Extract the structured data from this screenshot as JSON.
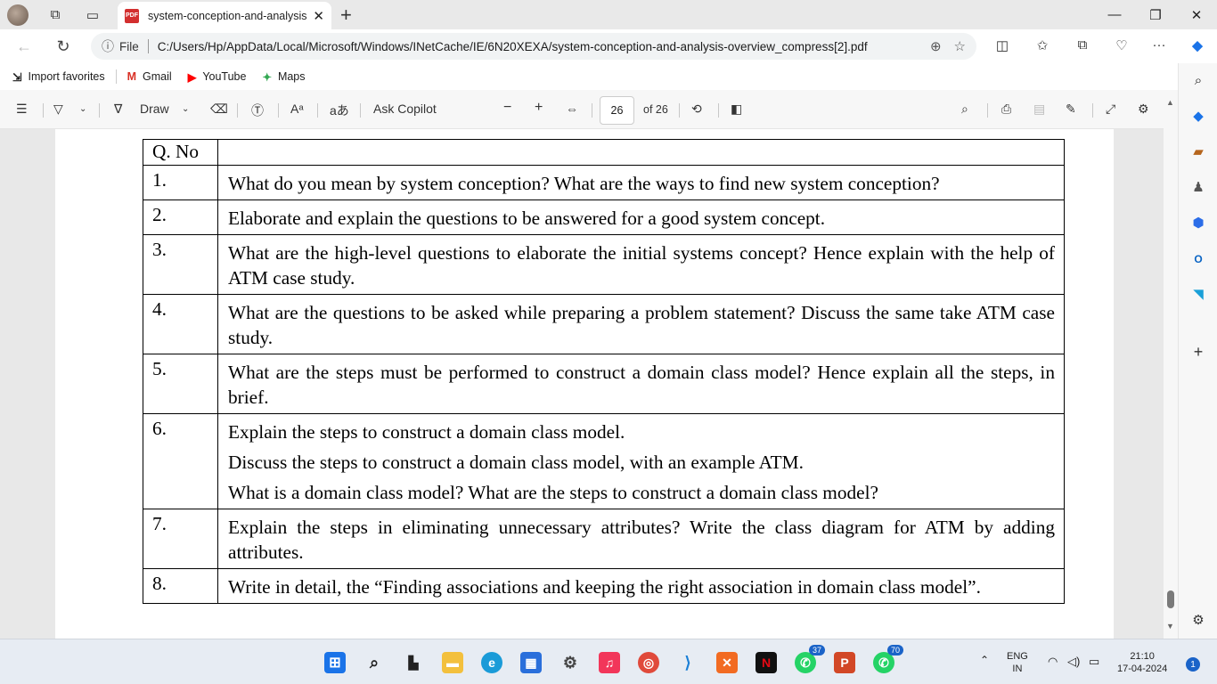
{
  "browser": {
    "tab_title": "system-conception-and-analysis-",
    "tab_badge": "PDF",
    "address_prefix": "File",
    "url": "C:/Users/Hp/AppData/Local/Microsoft/Windows/INetCache/IE/6N20XEXA/system-conception-and-analysis-overview_compress[2].pdf"
  },
  "favorites": [
    {
      "label": "Import favorites",
      "icon": "import-icon"
    },
    {
      "label": "Gmail",
      "icon": "gmail-icon"
    },
    {
      "label": "YouTube",
      "icon": "youtube-icon"
    },
    {
      "label": "Maps",
      "icon": "maps-icon"
    }
  ],
  "pdf_toolbar": {
    "draw_label": "Draw",
    "copilot_label": "Ask Copilot",
    "current_page": "26",
    "total_pages": "of 26"
  },
  "document": {
    "header_col1": "Q. No",
    "header_col2": "",
    "rows": [
      {
        "num": "1.",
        "lines": [
          "What do you mean by system conception? What are the ways to find new system conception?"
        ]
      },
      {
        "num": "2.",
        "lines": [
          "Elaborate and explain the questions to be answered for a good system concept."
        ]
      },
      {
        "num": "3.",
        "lines": [
          "What are the high-level questions to elaborate the initial systems concept? Hence explain with the help of ATM case study."
        ]
      },
      {
        "num": "4.",
        "lines": [
          "What are the questions to be asked while preparing a problem statement? Discuss the same take ATM case study."
        ]
      },
      {
        "num": "5.",
        "lines": [
          "What are the steps must be performed to construct a domain class model? Hence explain all the steps, in brief."
        ]
      },
      {
        "num": "6.",
        "lines": [
          "Explain the steps to construct a domain class model.",
          "Discuss the steps to construct a domain class model, with an example ATM.",
          "What is a domain class model? What are the steps to construct a domain class model?"
        ]
      },
      {
        "num": "7.",
        "lines": [
          "Explain the steps in eliminating unnecessary attributes? Write the class diagram for ATM by adding attributes."
        ]
      },
      {
        "num": "8.",
        "lines": [
          "Write in detail, the “Finding associations and keeping the right association in domain class model”."
        ]
      }
    ]
  },
  "taskbar": {
    "whatsapp_badge": "37",
    "whatsapp2_badge": "70",
    "language": "ENG",
    "region": "IN",
    "time": "21:10",
    "date": "17-04-2024",
    "notification_count": "1"
  }
}
